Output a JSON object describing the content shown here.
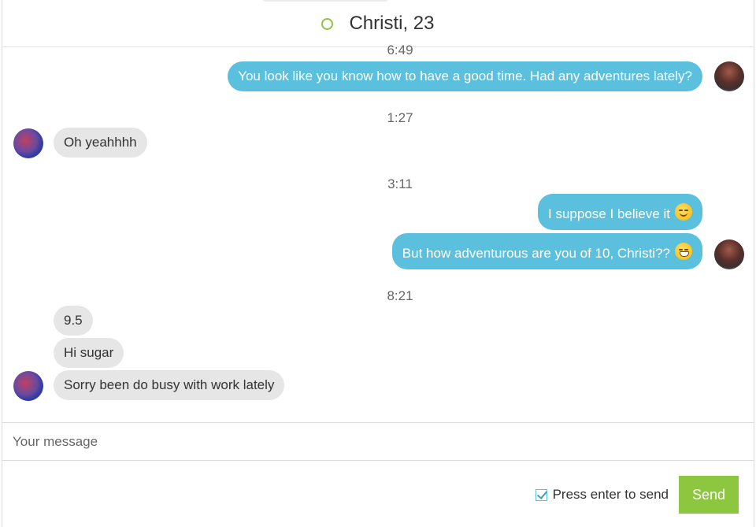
{
  "header": {
    "contact_name": "Christi, 23",
    "status_color": "#8dc63f"
  },
  "messages": [
    {
      "type": "timestamp",
      "text": "6:49"
    },
    {
      "type": "message",
      "direction": "out",
      "text": "You look like you know how to have a good time. Had any adventures lately?"
    },
    {
      "type": "timestamp",
      "text": "1:27"
    },
    {
      "type": "message",
      "direction": "in",
      "text": "Oh yeahhhh"
    },
    {
      "type": "timestamp",
      "text": "3:11"
    },
    {
      "type": "message",
      "direction": "out",
      "text": "I suppose I believe it",
      "emoji": "smirk-emoji"
    },
    {
      "type": "message",
      "direction": "out",
      "text": "But how adventurous are you of 10, Christi??",
      "emoji": "grimace-emoji"
    },
    {
      "type": "timestamp",
      "text": "8:21"
    },
    {
      "type": "message",
      "direction": "in",
      "text": "9.5"
    },
    {
      "type": "message",
      "direction": "in",
      "text": "Hi sugar"
    },
    {
      "type": "message",
      "direction": "in",
      "text": "Sorry been do busy with work lately"
    }
  ],
  "composer": {
    "placeholder": "Your message",
    "enter_to_send_label": "Press enter to send",
    "enter_to_send_checked": true,
    "send_label": "Send"
  },
  "colors": {
    "outgoing_bubble": "#5bc0de",
    "incoming_bubble": "#e6e6e6",
    "send_button": "#8dc63f"
  }
}
